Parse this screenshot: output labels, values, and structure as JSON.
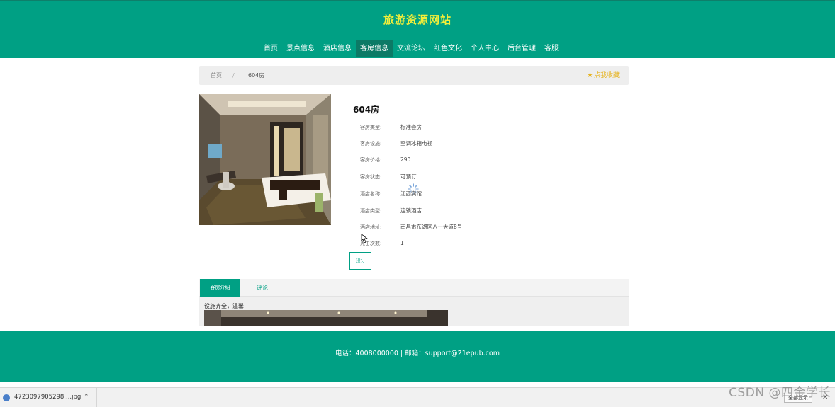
{
  "header": {
    "site_title": "旅游资源网站",
    "nav": [
      {
        "label": "首页",
        "active": false
      },
      {
        "label": "景点信息",
        "active": false
      },
      {
        "label": "酒店信息",
        "active": false
      },
      {
        "label": "客房信息",
        "active": true
      },
      {
        "label": "交流论坛",
        "active": false
      },
      {
        "label": "红色文化",
        "active": false
      },
      {
        "label": "个人中心",
        "active": false
      },
      {
        "label": "后台管理",
        "active": false
      },
      {
        "label": "客服",
        "active": false
      }
    ]
  },
  "breadcrumb": {
    "home": "首页",
    "separator": "/",
    "current": "604房",
    "favorite": "点我收藏"
  },
  "room": {
    "title": "604房",
    "fields": [
      {
        "label": "客房类型:",
        "value": "标准套房"
      },
      {
        "label": "客房设施:",
        "value": "空调冰箱电视"
      },
      {
        "label": "客房价格:",
        "value": "290"
      },
      {
        "label": "客房状态:",
        "value": "可预订"
      },
      {
        "label": "酒店名称:",
        "value": "江西宾馆"
      },
      {
        "label": "酒店类型:",
        "value": "连锁酒店"
      },
      {
        "label": "酒店地址:",
        "value": "南昌市东湖区八一大道8号"
      },
      {
        "label": "点击次数:",
        "value": "1"
      }
    ],
    "book_button": "预订"
  },
  "tabs": {
    "intro": "客房介绍",
    "comment": "评论",
    "intro_text": "设施齐全，温馨"
  },
  "footer": {
    "contact": "电话：4008000000 | 邮箱：support@21epub.com"
  },
  "download_bar": {
    "file_name": "4723097905298....jpg",
    "show_all": "全部显示"
  },
  "watermark": "CSDN @四金学长",
  "colors": {
    "primary": "#00a084",
    "title_yellow": "#f2ee3a",
    "favorite": "#e6b422"
  },
  "icons": {
    "favorite": "star-icon",
    "download": "file-icon",
    "more": "chevron-up-icon",
    "close": "close-icon"
  }
}
